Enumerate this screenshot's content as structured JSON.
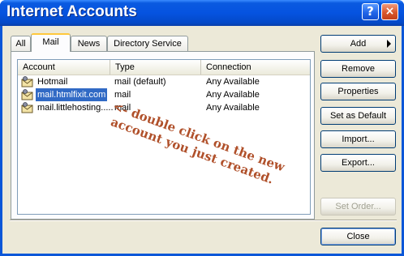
{
  "window": {
    "title": "Internet Accounts",
    "help_label": "?",
    "close_label": "×"
  },
  "tabs": [
    {
      "label": "All",
      "active": false
    },
    {
      "label": "Mail",
      "active": true
    },
    {
      "label": "News",
      "active": false
    },
    {
      "label": "Directory Service",
      "active": false
    }
  ],
  "list": {
    "columns": [
      "Account",
      "Type",
      "Connection"
    ],
    "rows": [
      {
        "account": "Hotmail",
        "type": "mail (default)",
        "connection": "Any Available",
        "selected": false,
        "icon": "mail-account-icon"
      },
      {
        "account": "mail.htmlfixit.com",
        "type": "mail",
        "connection": "Any Available",
        "selected": true,
        "icon": "mail-account-icon"
      },
      {
        "account": "mail.littlehosting.....",
        "type": "mail",
        "connection": "Any Available",
        "selected": false,
        "icon": "mail-account-icon"
      }
    ]
  },
  "annotation": {
    "lines": [
      "<- double click on the new",
      "account you just created."
    ],
    "color": "#b0502a"
  },
  "buttons": {
    "add": "Add",
    "remove": "Remove",
    "properties": "Properties",
    "set_default": "Set as Default",
    "import": "Import...",
    "export": "Export...",
    "set_order": "Set Order...",
    "close": "Close"
  },
  "colors": {
    "titlebar": "#0553e0",
    "selection": "#316ac5",
    "active_tab_accent": "#ffc83c"
  }
}
